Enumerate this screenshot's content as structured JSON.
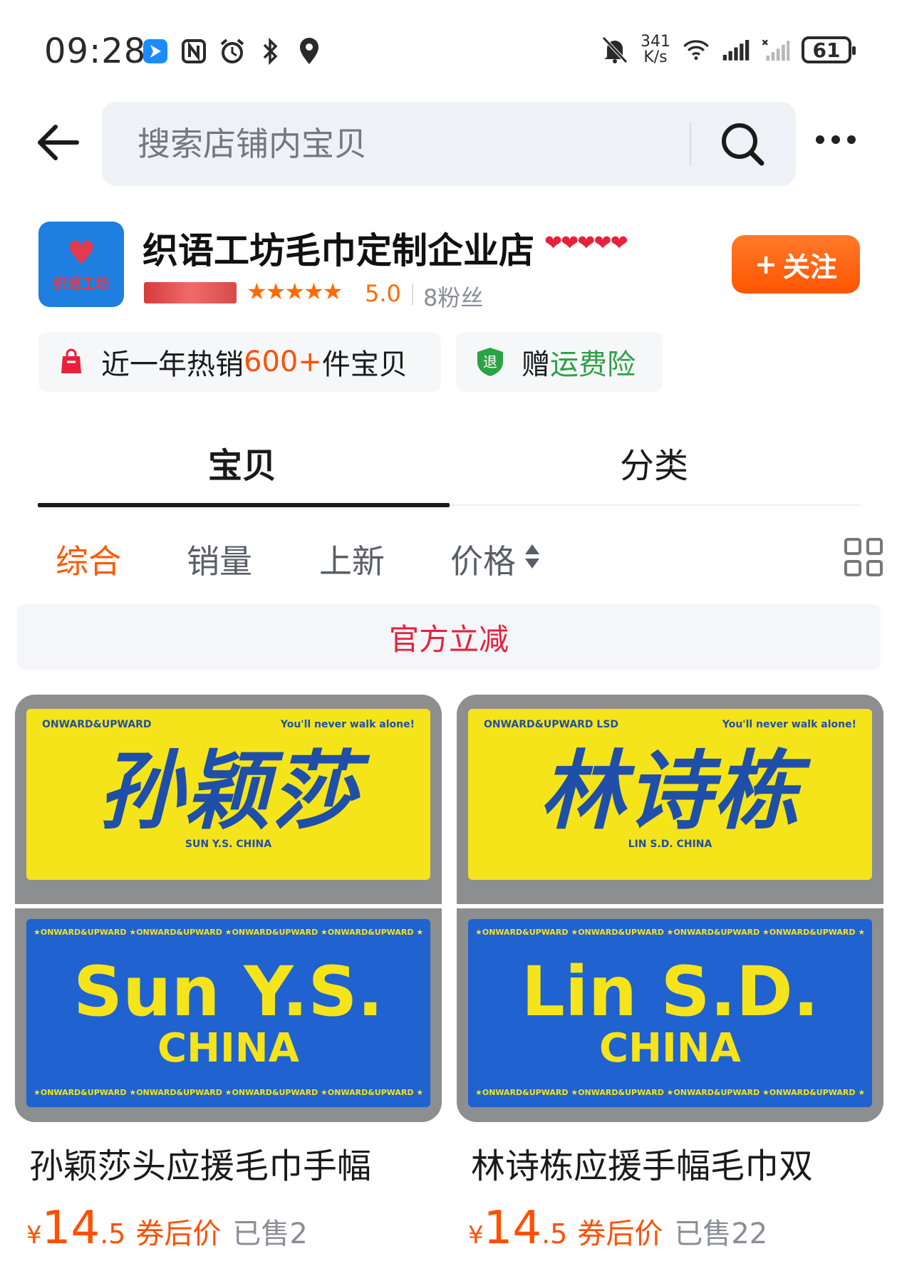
{
  "status_bar": {
    "time": "09:28",
    "net_speed_value": "341",
    "net_speed_unit": "K/s",
    "battery": "61",
    "left_icons": [
      "app-notification-icon",
      "nfc-icon",
      "alarm-icon",
      "bluetooth-icon",
      "location-icon"
    ],
    "right_icons": [
      "mute-icon",
      "wifi-icon",
      "signal-icon",
      "no-signal-icon"
    ]
  },
  "header": {
    "search_placeholder": "搜索店铺内宝贝"
  },
  "shop": {
    "logo_text": "织语工坊",
    "name": "织语工坊毛巾定制企业店",
    "hearts": "❤❤❤❤❤",
    "stars": "★★★★★",
    "rating": "5.0",
    "fans": "8粉丝",
    "follow_label": "关注",
    "follow_plus": "+"
  },
  "tags": {
    "hot_prefix": "近一年热销",
    "hot_number": "600+",
    "hot_suffix": "件宝贝",
    "ship_icon_text": "退",
    "ship_prefix": "赠",
    "ship_suffix": "运费险"
  },
  "tabs": [
    "宝贝",
    "分类"
  ],
  "filters": [
    "综合",
    "销量",
    "上新",
    "价格"
  ],
  "promo": "官方立减",
  "products": [
    {
      "image": {
        "top_left": "ONWARD&UPWARD",
        "top_right": "You'll never walk alone!",
        "name_cn": "孙颖莎",
        "sub": "SUN Y.S. CHINA",
        "stripe": "★ONWARD&UPWARD ★ONWARD&UPWARD ★ONWARD&UPWARD ★ONWARD&UPWARD ★",
        "name_en": "Sun Y.S.",
        "country": "CHINA"
      },
      "title": "孙颖莎头应援毛巾手幅",
      "price_yen": "¥",
      "price_int": "14",
      "price_dec": ".5",
      "price_label": "券后价",
      "sold": "已售2"
    },
    {
      "image": {
        "top_left": "ONWARD&UPWARD LSD",
        "top_right": "You'll never walk alone!",
        "name_cn": "林诗栋",
        "sub": "LIN S.D. CHINA",
        "stripe": "★ONWARD&UPWARD ★ONWARD&UPWARD ★ONWARD&UPWARD ★ONWARD&UPWARD ★",
        "name_en": "Lin S.D.",
        "country": "CHINA"
      },
      "title": "林诗栋应援手幅毛巾双",
      "price_yen": "¥",
      "price_int": "14",
      "price_dec": ".5",
      "price_label": "券后价",
      "sold": "已售22"
    }
  ],
  "colors": {
    "accent_orange": "#ff5000",
    "promo_red": "#e8213a",
    "shield_green": "#2ba245",
    "towel_yellow": "#f5e41a",
    "towel_blue": "#1f62d0"
  }
}
